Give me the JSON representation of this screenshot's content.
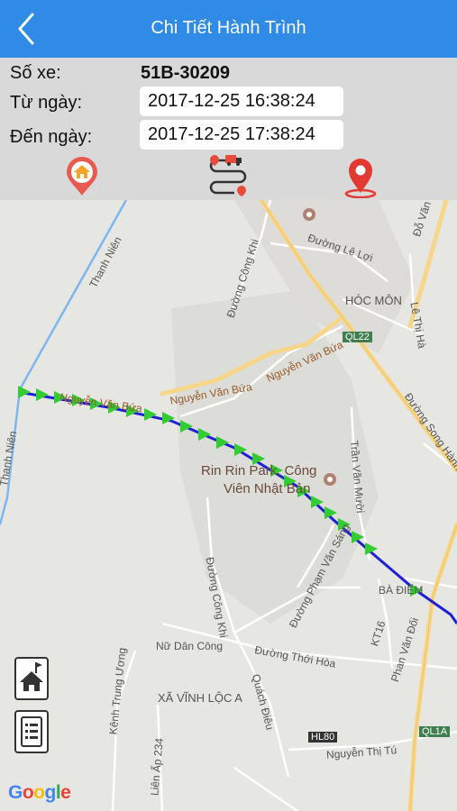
{
  "header": {
    "title": "Chi Tiết Hành Trình"
  },
  "info": {
    "plate_label": "Số xe:",
    "plate_value": "51B-30209",
    "from_label": "Từ ngày:",
    "from_value": "2017-12-25 16:38:24",
    "to_label": "Đến ngày:",
    "to_value": "2017-12-25 17:38:24"
  },
  "toolbar": {
    "icons": [
      "home-pin-icon",
      "route-icon",
      "location-pin-icon"
    ],
    "accent": "#e74c3c"
  },
  "map": {
    "labels": {
      "thanh_nien_1": "Thanh Niên",
      "thanh_nien_2": "Thanh Niên",
      "duong_cong_khi_1": "Đường Công Khi",
      "duong_le_loi": "Đường Lê Lợi",
      "do_van": "Đỗ Văn",
      "hoc_mon": "HÓC MÔN",
      "le_thi_ha": "Lê Thị Hà",
      "ql22": "QL22",
      "nguyen_van_bua_1": "Nguyễn Văn Bứa",
      "nguyen_van_bua_2": "Nguyễn Văn Bứa",
      "nguyen_van_bua_3": "Nguyễn Văn Bứa",
      "duong_song_hanh": "Đường Song Hành",
      "tran_van_muoi": "Trần Văn Mười",
      "park_line1": "Rin Rin Park, Công",
      "park_line2": "Viên Nhật Bản",
      "duong_pham_van_sang": "Đường Phạm Văn Sáng",
      "duong_cong_khi_2": "Đường Công Khi",
      "ba_diem": "BÀ ĐIỂM",
      "kt16": "KT16",
      "phan_van_doi": "Phan Văn Đối",
      "nu_dan_cong": "Nữ Dân Công",
      "duong_thoi_hoa": "Đường Thới Hòa",
      "kenh_trung_uong": "Kênh Trung Ương",
      "xa_vinh_loc_a": "XÃ VĨNH LỘC A",
      "quach_dieu": "Quách Điêu",
      "lien_ap": "Liên Ấp 234",
      "hl80": "HL80",
      "ql1a": "QL1A",
      "nguyen_thi_tu": "Nguyễn Thị Tú"
    },
    "route_color": "#1f1fd6",
    "marker_color": "#33cc33",
    "logo": "Google"
  },
  "map_controls": [
    "home-flag-icon",
    "list-icon"
  ]
}
